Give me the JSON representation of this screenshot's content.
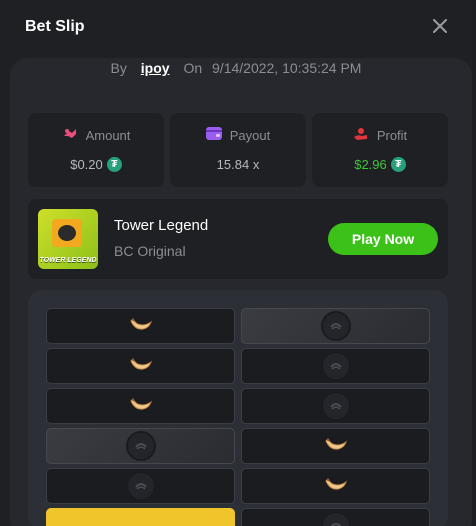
{
  "modal": {
    "title": "Bet Slip"
  },
  "meta": {
    "by_label": "By",
    "user": "ipoy",
    "on_label": "On",
    "timestamp": "9/14/2022, 10:35:24 PM"
  },
  "stats": [
    {
      "label": "Amount",
      "value": "$0.20",
      "icon": "amount-icon",
      "coin": "tether-coin-icon",
      "color": "#ea4e7a"
    },
    {
      "label": "Payout",
      "value": "15.84 x",
      "icon": "payout-icon",
      "color": "#9b5df0"
    },
    {
      "label": "Profit",
      "value": "$2.96",
      "icon": "profit-icon",
      "coin": "tether-coin-icon",
      "color": "#e2353d",
      "value_color": "#3ec637"
    }
  ],
  "game": {
    "name": "Tower Legend",
    "provider": "BC Original",
    "thumb_text": "TOWER LEGEND",
    "play_label": "Play Now"
  },
  "board": {
    "rows": [
      [
        "banana",
        "mine"
      ],
      [
        "banana",
        "skull"
      ],
      [
        "banana",
        "skull"
      ],
      [
        "mine",
        "banana"
      ],
      [
        "skull",
        "banana"
      ],
      [
        "gold",
        "skull"
      ]
    ]
  },
  "colors": {
    "accent_green": "#3bc117",
    "coin": "#26a17b",
    "gold": "#f0c42b"
  }
}
